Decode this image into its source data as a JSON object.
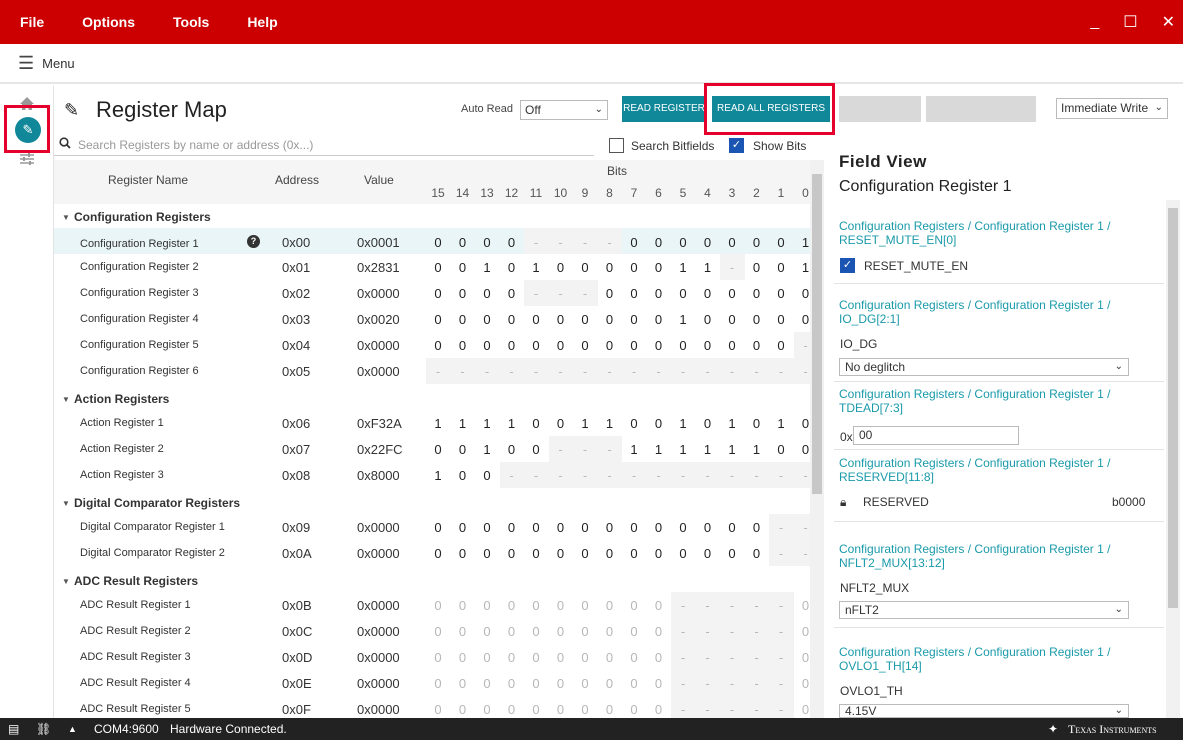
{
  "menubar": {
    "items": [
      "File",
      "Options",
      "Tools",
      "Help"
    ],
    "min": "_",
    "max": "☐",
    "close": "✕"
  },
  "menu_label": "Menu",
  "page_title": "Register Map",
  "toolbar": {
    "auto_read_label": "Auto Read",
    "auto_read_value": "Off",
    "read_register": "READ REGISTER",
    "read_all": "READ ALL REGISTERS",
    "write_mode": "Immediate Write"
  },
  "search": {
    "placeholder": "Search Registers by name or address (0x...)",
    "search_bitfields": "Search Bitfields",
    "show_bits": "Show Bits"
  },
  "headers": {
    "name": "Register Name",
    "address": "Address",
    "value": "Value",
    "bits": "Bits"
  },
  "bit_labels": [
    "15",
    "14",
    "13",
    "12",
    "11",
    "10",
    "9",
    "8",
    "7",
    "6",
    "5",
    "4",
    "3",
    "2",
    "1",
    "0"
  ],
  "groups": [
    {
      "name": "Configuration Registers",
      "registers": [
        {
          "name": "Configuration Register 1",
          "address": "0x00",
          "value": "0x0001",
          "bits": [
            "0",
            "0",
            "0",
            "0",
            "-",
            "-",
            "-",
            "-",
            "0",
            "0",
            "0",
            "0",
            "0",
            "0",
            "0",
            "1"
          ],
          "selected": true
        },
        {
          "name": "Configuration Register 2",
          "address": "0x01",
          "value": "0x2831",
          "bits": [
            "0",
            "0",
            "1",
            "0",
            "1",
            "0",
            "0",
            "0",
            "0",
            "0",
            "1",
            "1",
            "-",
            "0",
            "0",
            "1"
          ]
        },
        {
          "name": "Configuration Register 3",
          "address": "0x02",
          "value": "0x0000",
          "bits": [
            "0",
            "0",
            "0",
            "0",
            "-",
            "-",
            "-",
            "0",
            "0",
            "0",
            "0",
            "0",
            "0",
            "0",
            "0",
            "0"
          ]
        },
        {
          "name": "Configuration Register 4",
          "address": "0x03",
          "value": "0x0020",
          "bits": [
            "0",
            "0",
            "0",
            "0",
            "0",
            "0",
            "0",
            "0",
            "0",
            "0",
            "1",
            "0",
            "0",
            "0",
            "0",
            "0"
          ]
        },
        {
          "name": "Configuration Register 5",
          "address": "0x04",
          "value": "0x0000",
          "bits": [
            "0",
            "0",
            "0",
            "0",
            "0",
            "0",
            "0",
            "0",
            "0",
            "0",
            "0",
            "0",
            "0",
            "0",
            "0",
            "-"
          ]
        },
        {
          "name": "Configuration Register 6",
          "address": "0x05",
          "value": "0x0000",
          "bits": [
            "-",
            "-",
            "-",
            "-",
            "-",
            "-",
            "-",
            "-",
            "-",
            "-",
            "-",
            "-",
            "-",
            "-",
            "-",
            "-"
          ]
        }
      ]
    },
    {
      "name": "Action Registers",
      "registers": [
        {
          "name": "Action Register 1",
          "address": "0x06",
          "value": "0xF32A",
          "bits": [
            "1",
            "1",
            "1",
            "1",
            "0",
            "0",
            "1",
            "1",
            "0",
            "0",
            "1",
            "0",
            "1",
            "0",
            "1",
            "0"
          ]
        },
        {
          "name": "Action Register 2",
          "address": "0x07",
          "value": "0x22FC",
          "bits": [
            "0",
            "0",
            "1",
            "0",
            "0",
            "-",
            "-",
            "-",
            "1",
            "1",
            "1",
            "1",
            "1",
            "1",
            "0",
            "0"
          ]
        },
        {
          "name": "Action Register 3",
          "address": "0x08",
          "value": "0x8000",
          "bits": [
            "1",
            "0",
            "0",
            "-",
            "-",
            "-",
            "-",
            "-",
            "-",
            "-",
            "-",
            "-",
            "-",
            "-",
            "-",
            "-"
          ]
        }
      ]
    },
    {
      "name": "Digital Comparator Registers",
      "registers": [
        {
          "name": "Digital Comparator Register 1",
          "address": "0x09",
          "value": "0x0000",
          "bits": [
            "0",
            "0",
            "0",
            "0",
            "0",
            "0",
            "0",
            "0",
            "0",
            "0",
            "0",
            "0",
            "0",
            "0",
            "-",
            "-"
          ]
        },
        {
          "name": "Digital Comparator Register 2",
          "address": "0x0A",
          "value": "0x0000",
          "bits": [
            "0",
            "0",
            "0",
            "0",
            "0",
            "0",
            "0",
            "0",
            "0",
            "0",
            "0",
            "0",
            "0",
            "0",
            "-",
            "-"
          ]
        }
      ]
    },
    {
      "name": "ADC Result Registers",
      "registers": [
        {
          "name": "ADC Result Register 1",
          "address": "0x0B",
          "value": "0x0000",
          "grey": true,
          "bits": [
            "0",
            "0",
            "0",
            "0",
            "0",
            "0",
            "0",
            "0",
            "0",
            "0",
            "-",
            "-",
            "-",
            "-",
            "-",
            "0"
          ]
        },
        {
          "name": "ADC Result Register 2",
          "address": "0x0C",
          "value": "0x0000",
          "grey": true,
          "bits": [
            "0",
            "0",
            "0",
            "0",
            "0",
            "0",
            "0",
            "0",
            "0",
            "0",
            "-",
            "-",
            "-",
            "-",
            "-",
            "0"
          ]
        },
        {
          "name": "ADC Result Register 3",
          "address": "0x0D",
          "value": "0x0000",
          "grey": true,
          "bits": [
            "0",
            "0",
            "0",
            "0",
            "0",
            "0",
            "0",
            "0",
            "0",
            "0",
            "-",
            "-",
            "-",
            "-",
            "-",
            "0"
          ]
        },
        {
          "name": "ADC Result Register 4",
          "address": "0x0E",
          "value": "0x0000",
          "grey": true,
          "bits": [
            "0",
            "0",
            "0",
            "0",
            "0",
            "0",
            "0",
            "0",
            "0",
            "0",
            "-",
            "-",
            "-",
            "-",
            "-",
            "0"
          ]
        },
        {
          "name": "ADC Result Register 5",
          "address": "0x0F",
          "value": "0x0000",
          "grey": true,
          "bits": [
            "0",
            "0",
            "0",
            "0",
            "0",
            "0",
            "0",
            "0",
            "0",
            "0",
            "-",
            "-",
            "-",
            "-",
            "-",
            "0"
          ]
        }
      ]
    }
  ],
  "field_view": {
    "title": "Field View",
    "subtitle": "Configuration Register 1",
    "fields": [
      {
        "link": "Configuration Registers / Configuration Register 1 / RESET_MUTE_EN[0]",
        "label": "RESET_MUTE_EN",
        "checked": true
      },
      {
        "link": "Configuration Registers / Configuration Register 1 / IO_DG[2:1]",
        "label": "IO_DG",
        "select": "No deglitch"
      },
      {
        "link": "Configuration Registers / Configuration Register 1 / TDEAD[7:3]",
        "prefix": "0x",
        "input": "00"
      },
      {
        "link": "Configuration Registers / Configuration Register 1 / RESERVED[11:8]",
        "label": "RESERVED",
        "value": "b0000"
      },
      {
        "link": "Configuration Registers / Configuration Register 1 / NFLT2_MUX[13:12]",
        "label": "NFLT2_MUX",
        "select": "nFLT2"
      },
      {
        "link": "Configuration Registers / Configuration Register 1 / OVLO1_TH[14]",
        "label": "OVLO1_TH",
        "select": "4.15V"
      }
    ]
  },
  "status": {
    "port": "COM4:9600",
    "message": "Hardware Connected.",
    "brand": "Texas Instruments"
  }
}
